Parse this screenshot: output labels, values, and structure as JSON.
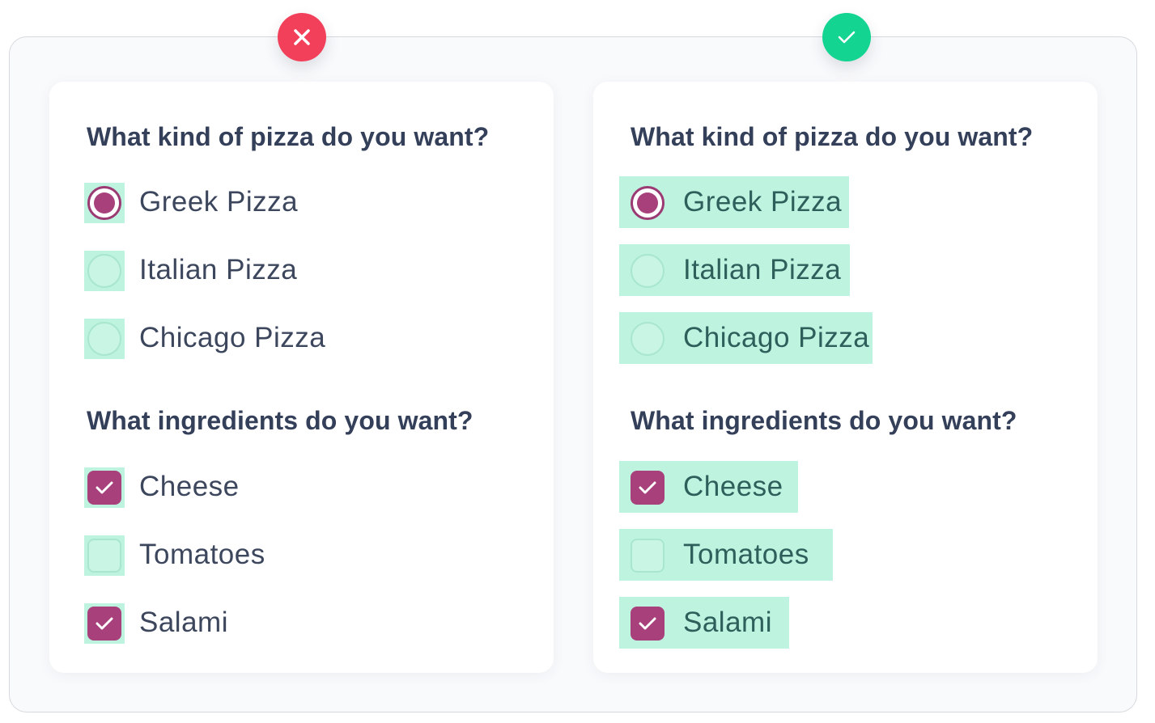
{
  "comparison": {
    "bad_badge_icon": "close-icon",
    "good_badge_icon": "checkmark-icon",
    "bad_color": "#f2405b",
    "good_color": "#14d491",
    "highlight_color": "#bdf3df",
    "accent_color": "#a8407c"
  },
  "left_card": {
    "pizza_question": "What kind of pizza do you want?",
    "pizza_options": [
      {
        "label": "Greek Pizza",
        "checked": true
      },
      {
        "label": "Italian Pizza",
        "checked": false
      },
      {
        "label": "Chicago Pizza",
        "checked": false
      }
    ],
    "ingredients_question": "What ingredients do you want?",
    "ingredient_options": [
      {
        "label": "Cheese",
        "checked": true
      },
      {
        "label": "Tomatoes",
        "checked": false
      },
      {
        "label": "Salami",
        "checked": true
      }
    ]
  },
  "right_card": {
    "pizza_question": "What kind of pizza do you want?",
    "pizza_options": [
      {
        "label": "Greek Pizza",
        "checked": true
      },
      {
        "label": "Italian Pizza",
        "checked": false
      },
      {
        "label": "Chicago Pizza",
        "checked": false
      }
    ],
    "ingredients_question": "What ingredients do you want?",
    "ingredient_options": [
      {
        "label": "Cheese",
        "checked": true
      },
      {
        "label": "Tomatoes",
        "checked": false
      },
      {
        "label": "Salami",
        "checked": true
      }
    ]
  }
}
